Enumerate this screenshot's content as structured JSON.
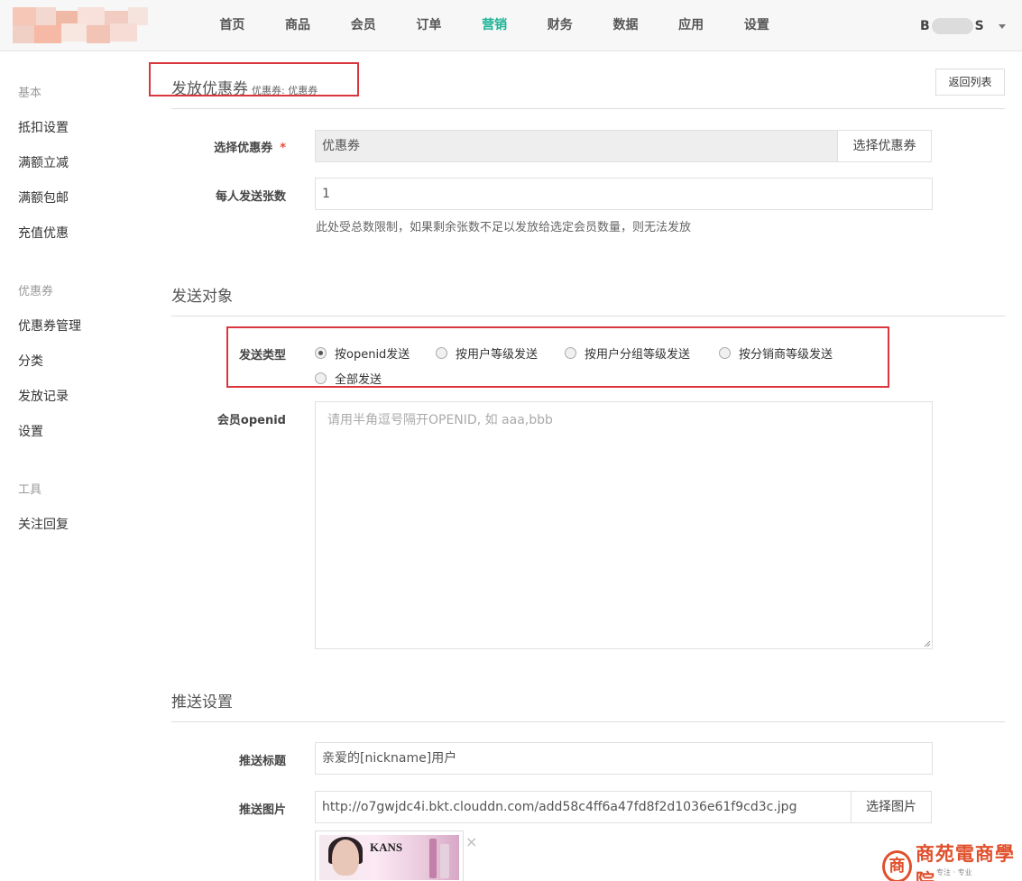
{
  "nav": {
    "items": [
      "首页",
      "商品",
      "会员",
      "订单",
      "营销",
      "财务",
      "数据",
      "应用",
      "设置"
    ],
    "active_index": 4,
    "user": {
      "name_start": "B",
      "name_end": "S"
    }
  },
  "sidebar": {
    "groups": [
      {
        "title": "基本",
        "items": [
          "抵扣设置",
          "满额立减",
          "满额包邮",
          "充值优惠"
        ]
      },
      {
        "title": "优惠券",
        "items": [
          "优惠券管理",
          "分类",
          "发放记录",
          "设置"
        ]
      },
      {
        "title": "工具",
        "items": [
          "关注回复"
        ]
      }
    ]
  },
  "page": {
    "title": "发放优惠券",
    "subtitle": "优惠券: 优惠券",
    "back_label": "返回列表"
  },
  "form": {
    "coupon": {
      "label": "选择优惠券",
      "value": "优惠券",
      "button": "选择优惠券"
    },
    "per_person": {
      "label": "每人发送张数",
      "value": "1",
      "help": "此处受总数限制，如果剩余张数不足以发放给选定会员数量，则无法发放"
    }
  },
  "target": {
    "section_title": "发送对象",
    "type_label": "发送类型",
    "options": [
      "按openid发送",
      "按用户等级发送",
      "按用户分组等级发送",
      "按分销商等级发送",
      "全部发送"
    ],
    "selected_index": 0,
    "openid_label": "会员openid",
    "openid_placeholder": "请用半角逗号隔开OPENID, 如 aaa,bbb"
  },
  "push": {
    "section_title": "推送设置",
    "title_label": "推送标题",
    "title_value": "亲爱的[nickname]用户",
    "image_label": "推送图片",
    "image_url": "http://o7gwjdc4i.bkt.clouddn.com/add58c4ff6a47fd8f2d1036e61f9cd3c.jpg",
    "image_button": "选择图片",
    "thumb_brand": "KANS",
    "thumb_close": "×"
  },
  "watermark": {
    "icon": "商",
    "text": "商苑電商學院",
    "sub": "专注 · 专业"
  },
  "colors": {
    "accent": "#1ab394",
    "highlight": "#d9363e",
    "watermark": "#e0502c"
  }
}
